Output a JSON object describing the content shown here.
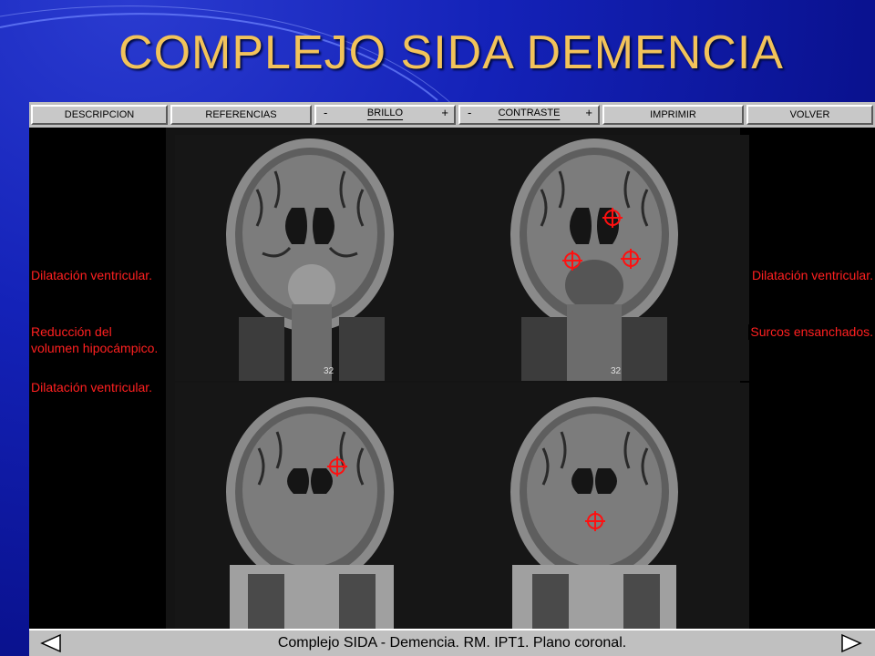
{
  "slide": {
    "title": "COMPLEJO SIDA DEMENCIA"
  },
  "toolbar": {
    "descripcion": "DESCRIPCION",
    "referencias": "REFERENCIAS",
    "brillo": "BRILLO",
    "contraste": "CONTRASTE",
    "minus": "-",
    "plus": "+",
    "imprimir": "IMPRIMIR",
    "volver": "VOLVER"
  },
  "annotations": {
    "left": [
      "Dilatación ventricular.",
      "Reducción del",
      "volumen hipocámpico.",
      "Dilatación ventricular."
    ],
    "right": [
      "Dilatación ventricular.",
      "Surcos ensanchados."
    ]
  },
  "scan_labels": {
    "top_left": "32",
    "top_right": "32"
  },
  "footer": {
    "caption": "Complejo SIDA - Demencia. RM. IPT1. Plano coronal."
  },
  "colors": {
    "title": "#f2c35a",
    "annotation": "#ff2020",
    "marker": "#ff1010"
  }
}
